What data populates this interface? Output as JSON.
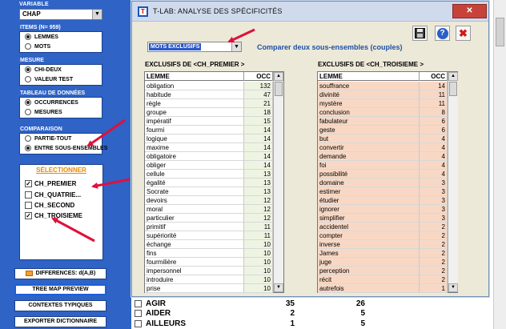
{
  "left_panel": {
    "variable_label": "VARIABLE",
    "variable_value": "CHAP",
    "items_group": {
      "title": "ITEMS (N= 959)",
      "options": [
        "LEMMES",
        "MOTS"
      ],
      "selected": 0
    },
    "measure_group": {
      "title": "MESURE",
      "options": [
        "CHI-DEUX",
        "VALEUR TEST"
      ],
      "selected": 0
    },
    "data_table_group": {
      "title": "TABLEAU DE DONNÉES",
      "options": [
        "OCCURRENCES",
        "MESURES"
      ],
      "selected": 0
    },
    "comparison_group": {
      "title": "COMPARAISON",
      "options": [
        "PARTIE-TOUT",
        "ENTRE SOUS-ENSEMBLES"
      ],
      "selected": 1
    },
    "select_box": {
      "title": "SÉLECTIONNER",
      "items": [
        {
          "label": "CH_PREMIER",
          "checked": true
        },
        {
          "label": "CH_QUATRIE...",
          "checked": false
        },
        {
          "label": "CH_SECOND",
          "checked": false
        },
        {
          "label": "CH_TROISIEME",
          "checked": true
        }
      ]
    },
    "buttons": {
      "differences": "DIFFERENCES: d(A,B)",
      "tree_map": "TREE MAP PREVIEW",
      "contexts": "CONTEXTES TYPIQUES",
      "export": "EXPORTER DICTIONNAIRE"
    }
  },
  "background_rows": [
    {
      "word": "AGIR",
      "v1": "35",
      "v2": "26"
    },
    {
      "word": "AIDER",
      "v1": "2",
      "v2": "5"
    },
    {
      "word": "AILLEURS",
      "v1": "1",
      "v2": "5"
    }
  ],
  "dialog": {
    "title": "T-LAB: ANALYSE DES SPÉCIFICITÉS",
    "close_glyph": "✕",
    "app_icon": "T",
    "mode_value": "MOTS EXCLUSIFS",
    "compare_label": "Comparer deux sous-ensembles (couples)",
    "icons": {
      "save": "save-icon",
      "help": "help-icon",
      "close": "close-icon"
    },
    "help_glyph": "?",
    "close_btn_glyph": "✖",
    "left_table": {
      "title": "EXCLUSIFS DE <CH_PREMIER >",
      "headers": [
        "LEMME",
        "OCC"
      ],
      "rows": [
        [
          "obligation",
          "132"
        ],
        [
          "habitude",
          "47"
        ],
        [
          "règle",
          "21"
        ],
        [
          "groupe",
          "18"
        ],
        [
          "impératif",
          "15"
        ],
        [
          "fourmi",
          "14"
        ],
        [
          "logique",
          "14"
        ],
        [
          "maxime",
          "14"
        ],
        [
          "obligatoire",
          "14"
        ],
        [
          "obliger",
          "14"
        ],
        [
          "cellule",
          "13"
        ],
        [
          "égalité",
          "13"
        ],
        [
          "Socrate",
          "13"
        ],
        [
          "devoirs",
          "12"
        ],
        [
          "moral",
          "12"
        ],
        [
          "particulier",
          "12"
        ],
        [
          "primitif",
          "11"
        ],
        [
          "supériorité",
          "11"
        ],
        [
          "échange",
          "10"
        ],
        [
          "fins",
          "10"
        ],
        [
          "fourmilière",
          "10"
        ],
        [
          "impersonnel",
          "10"
        ],
        [
          "introduire",
          "10"
        ],
        [
          "prise",
          "10"
        ]
      ]
    },
    "right_table": {
      "title": "EXCLUSIFS DE <CH_TROISIEME >",
      "headers": [
        "LEMME",
        "OCC"
      ],
      "rows": [
        [
          "souffrance",
          "14"
        ],
        [
          "divinité",
          "11"
        ],
        [
          "mystère",
          "11"
        ],
        [
          "conclusion",
          "8"
        ],
        [
          "fabulateur",
          "6"
        ],
        [
          "geste",
          "6"
        ],
        [
          "but",
          "4"
        ],
        [
          "convertir",
          "4"
        ],
        [
          "demande",
          "4"
        ],
        [
          "foi",
          "4"
        ],
        [
          "possibilité",
          "4"
        ],
        [
          "domaine",
          "3"
        ],
        [
          "estimer",
          "3"
        ],
        [
          "étudier",
          "3"
        ],
        [
          "ignorer",
          "3"
        ],
        [
          "simplifier",
          "3"
        ],
        [
          "accidentel",
          "2"
        ],
        [
          "compter",
          "2"
        ],
        [
          "inverse",
          "2"
        ],
        [
          "James",
          "2"
        ],
        [
          "juge",
          "2"
        ],
        [
          "perception",
          "2"
        ],
        [
          "récit",
          "2"
        ],
        [
          "autrefois",
          "1"
        ]
      ]
    }
  },
  "colors": {
    "panel_blue": "#2f63c5",
    "dialog_bg": "#ece9d8",
    "left_occ_bg": "#eef4e2",
    "right_row_bg": "#f8d8c4",
    "annotation_red": "#e0103a",
    "select_title_orange": "#e88a00"
  }
}
